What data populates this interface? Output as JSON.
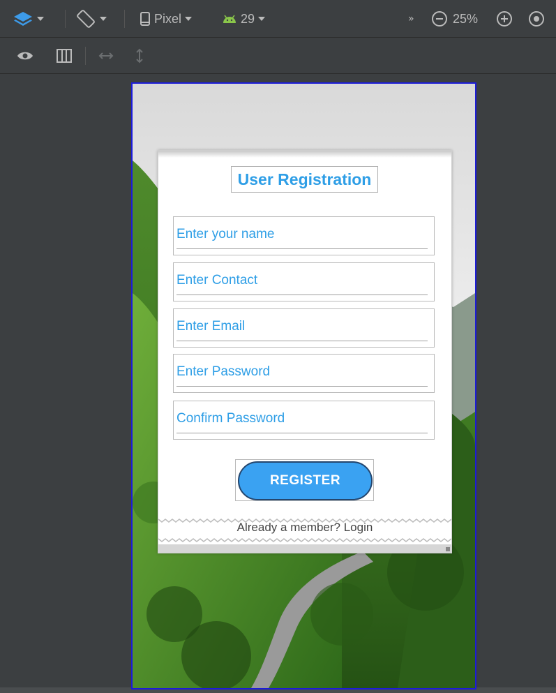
{
  "toolbar": {
    "device_label": "Pixel",
    "api_label": "29",
    "more_label": "»",
    "zoom_label": "25%"
  },
  "icons": {
    "layers": "layers-icon",
    "rotate": "rotate-icon",
    "phone": "phone-icon",
    "android": "android-icon",
    "zoom_out": "zoom-out-icon",
    "zoom_in": "zoom-in-icon",
    "zoom_fit": "zoom-fit-icon",
    "eye": "eye-icon",
    "columns": "columns-icon",
    "width": "horizontal-resize-icon",
    "height": "vertical-resize-icon"
  },
  "colors": {
    "accent": "#2e9ee6",
    "button": "#3aa2f2",
    "android_green": "#8ac64a",
    "device_border": "#1c1cd8"
  },
  "form": {
    "title": "User Registration",
    "name_placeholder": "Enter your name",
    "contact_placeholder": "Enter Contact",
    "email_placeholder": "Enter Email",
    "password_placeholder": "Enter Password",
    "confirm_placeholder": "Confirm Password",
    "register_label": "REGISTER",
    "login_text": "Already a member? Login"
  }
}
